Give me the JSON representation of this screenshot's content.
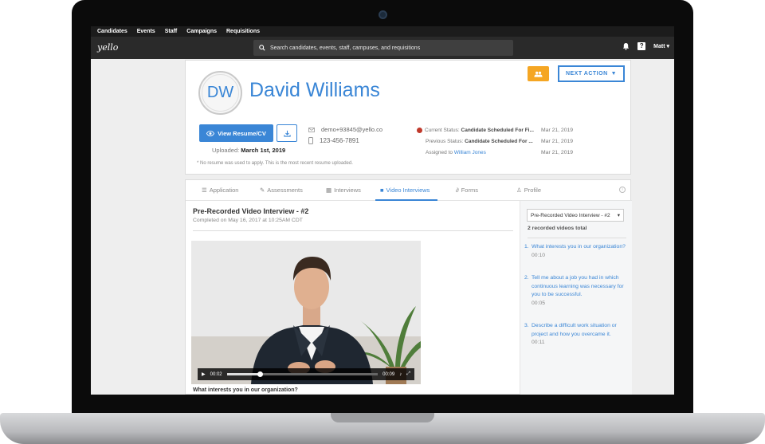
{
  "topnav": {
    "items": [
      "Candidates",
      "Events",
      "Staff",
      "Campaigns",
      "Requisitions"
    ]
  },
  "header": {
    "logo": "yello",
    "search_placeholder": "Search candidates, events, staff, campuses, and requisitions",
    "user": "Matt",
    "help_glyph": "?"
  },
  "candidate": {
    "initials": "DW",
    "name": "David Williams",
    "next_action_label": "NEXT ACTION",
    "view_resume_label": "View Resume/CV",
    "uploaded_label": "Uploaded:",
    "uploaded_date": "March 1st, 2019",
    "email": "demo+93845@yello.co",
    "phone": "123-456-7891",
    "current_status_label": "Current Status:",
    "current_status": "Candidate Scheduled For Fi...",
    "current_status_date": "Mar 21, 2019",
    "previous_status_label": "Previous Status:",
    "previous_status": "Candidate Scheduled For ...",
    "previous_status_date": "Mar 21, 2019",
    "assigned_label": "Assigned to",
    "assigned_to": "William Jones",
    "assigned_date": "Mar 21, 2019",
    "note": "* No resume was used to apply. This is the most recent resume uploaded."
  },
  "tabs": [
    {
      "label": "Application",
      "icon": "list-icon"
    },
    {
      "label": "Assessments",
      "icon": "edit-icon"
    },
    {
      "label": "Interviews",
      "icon": "calendar-icon"
    },
    {
      "label": "Video Interviews",
      "icon": "video-camera-icon"
    },
    {
      "label": "Forms",
      "icon": "paperclip-icon"
    },
    {
      "label": "Profile",
      "icon": "person-icon"
    }
  ],
  "active_tab": "Video Interviews",
  "video": {
    "title": "Pre-Recorded Video Interview - #2",
    "completed": "Completed on May 16, 2017 at 10:25AM CDT",
    "time_current": "00:02",
    "time_total": "00:09",
    "progress": 0.22,
    "caption": "What interests you in our organization?"
  },
  "sidebar": {
    "selected": "Pre-Recorded Video Interview - #2",
    "total": "2 recorded videos total",
    "questions": [
      {
        "num": "1.",
        "text": "What interests you in our organization?",
        "dur": "00:10"
      },
      {
        "num": "2.",
        "text": "Tell me about a job you had in which continuous learning was necessary for you to be successful.",
        "dur": "00:05"
      },
      {
        "num": "3.",
        "text": "Describe a difficult work situation or project and how you overcame it.",
        "dur": "00:11"
      }
    ]
  },
  "colors": {
    "accent": "#3a86d6",
    "team_button": "#f5a623",
    "status_dot": "#c0392b",
    "topbar": "#1c1c1c"
  }
}
